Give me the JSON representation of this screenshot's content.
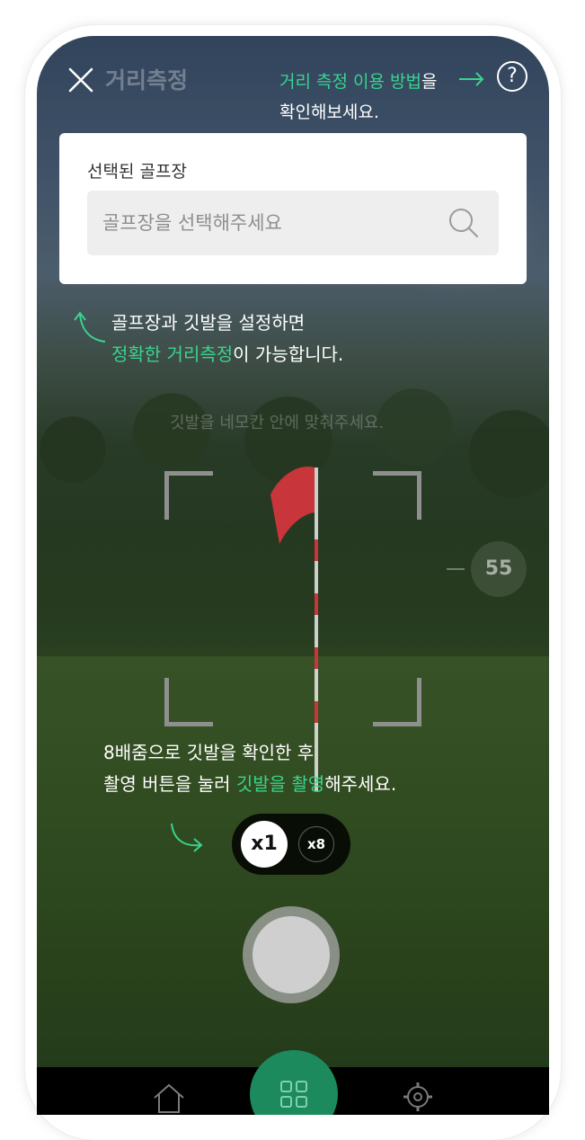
{
  "header": {
    "title": "거리측정",
    "guide_accent": "거리 측정 이용 방법",
    "guide_suffix": "을",
    "guide_line2": "확인해보세요."
  },
  "course_card": {
    "label": "선택된 골프장",
    "placeholder": "골프장을 선택해주세요"
  },
  "hint_top": {
    "line1": "골프장과 깃발을 설정하면",
    "accent": "정확한 거리측정",
    "suffix": "이 가능합니다."
  },
  "frame_guide": "깃발을 네모칸 안에 맞춰주세요.",
  "zoom": {
    "level": "55",
    "x1": "x1",
    "x8": "x8",
    "active": "x1"
  },
  "hint_bottom": {
    "line1": "8배줌으로 깃발을 확인한 후",
    "prefix": "촬영 버튼을 눌러 ",
    "accent": "깃발을 촬영",
    "suffix": "해주세요."
  },
  "colors": {
    "accent": "#3ad38f",
    "nav_center": "#1c8a5d",
    "flag": "#c8353a"
  },
  "icons": {
    "close": "close-icon",
    "help": "question-circle-icon",
    "search": "search-icon",
    "home": "home-icon",
    "grid": "grid-icon",
    "settings": "gear-icon"
  },
  "help_symbol": "?"
}
